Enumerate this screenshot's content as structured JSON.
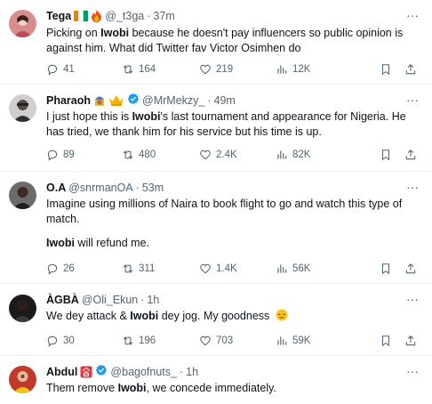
{
  "tweets": [
    {
      "name": "Tega",
      "handle": "@_t3ga",
      "time": "37m",
      "text_parts": [
        "Picking on ",
        "Iwobi",
        " because he doesn't pay influencers so public opinion is against him. What did Twitter fav Victor Osimhen do"
      ],
      "replies": "41",
      "retweets": "164",
      "likes": "219",
      "views": "12K",
      "emoji": [
        "ivory-coast-flag",
        "fire"
      ]
    },
    {
      "name": "Pharaoh",
      "handle": "@MrMekzy_",
      "time": "49m",
      "text_parts": [
        "I just hope this is ",
        "Iwobi",
        "'s last tournament and appearance for Nigeria. He has tried, we thank him for his service but his time is up."
      ],
      "replies": "89",
      "retweets": "480",
      "likes": "2.4K",
      "views": "82K",
      "emoji": [
        "pharaoh",
        "crown"
      ],
      "verified": true
    },
    {
      "name": "O.A",
      "handle": "@snrmanOA",
      "time": "53m",
      "text_parts": [
        "Imagine using millions of Naira to book flight to go and watch this type of match."
      ],
      "text_parts2": [
        "Iwobi",
        " will refund me."
      ],
      "replies": "26",
      "retweets": "311",
      "likes": "1.4K",
      "views": "56K"
    },
    {
      "name": "ÀGBÀ",
      "handle": "@Oli_Ekun",
      "time": "1h",
      "text_parts": [
        "We dey attack & ",
        "Iwobi",
        " dey jog. My goodness "
      ],
      "replies": "30",
      "retweets": "196",
      "likes": "703",
      "views": "59K",
      "emoji": [
        "relieved-face"
      ]
    },
    {
      "name": "Abdul",
      "handle": "@bagofnuts_",
      "time": "1h",
      "text_parts": [
        "Them remove ",
        "Iwobi",
        ", we concede immediately."
      ],
      "emoji": [
        "japanese-passing-grade-button"
      ],
      "verified": true
    }
  ],
  "colors": {
    "text": "#0f1419",
    "muted": "#536471",
    "verified": "#1d9bf0",
    "divider": "#eff3f4"
  }
}
